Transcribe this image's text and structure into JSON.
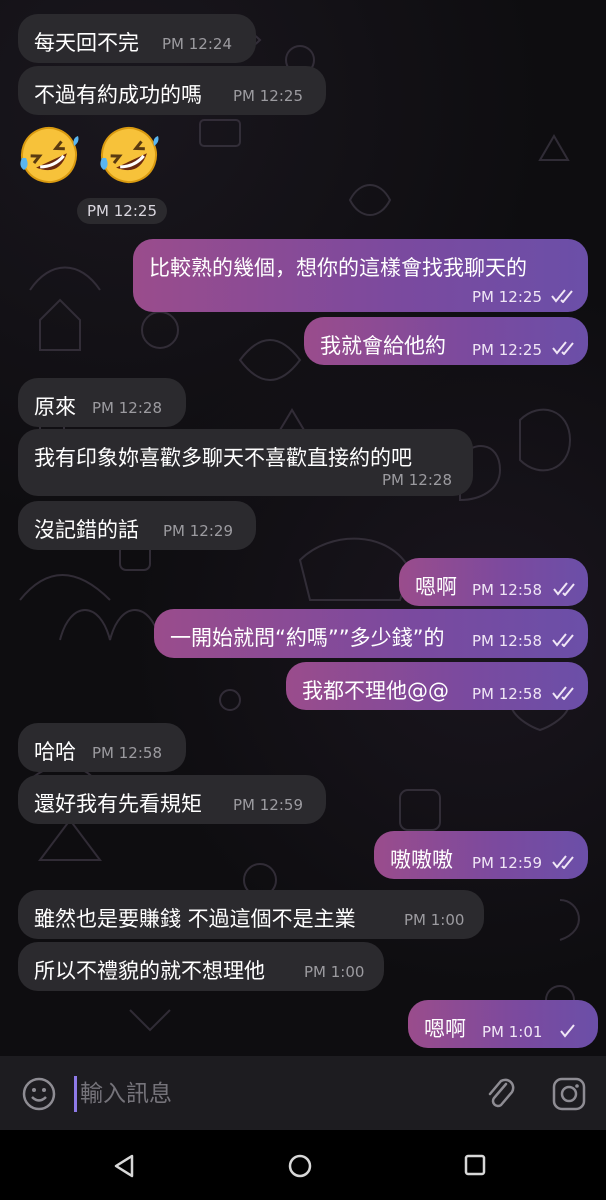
{
  "conversation": {
    "messages": [
      {
        "id": "m1",
        "dir": "in",
        "text": "每天回不完",
        "time": "PM 12:24"
      },
      {
        "id": "m2",
        "dir": "in",
        "text": "不過有約成功的嗎",
        "time": "PM 12:25"
      },
      {
        "id": "m3",
        "dir": "in",
        "emoji": [
          "rolling-on-floor-laughing",
          "rolling-on-floor-laughing"
        ],
        "time": "PM 12:25"
      },
      {
        "id": "m4",
        "dir": "out",
        "text": "比較熟的幾個，想你的這樣會找我聊天的",
        "time": "PM 12:25",
        "status": "read"
      },
      {
        "id": "m5",
        "dir": "out",
        "text": "我就會給他約",
        "time": "PM 12:25",
        "status": "read"
      },
      {
        "id": "m6",
        "dir": "in",
        "text": "原來",
        "time": "PM 12:28"
      },
      {
        "id": "m7",
        "dir": "in",
        "text": "我有印象妳喜歡多聊天不喜歡直接約的吧",
        "time": "PM 12:28"
      },
      {
        "id": "m8",
        "dir": "in",
        "text": "沒記錯的話",
        "time": "PM 12:29"
      },
      {
        "id": "m9",
        "dir": "out",
        "text": "嗯啊",
        "time": "PM 12:58",
        "status": "read"
      },
      {
        "id": "m10",
        "dir": "out",
        "text": "一開始就問“約嗎””多少錢”的",
        "time": "PM 12:58",
        "status": "read"
      },
      {
        "id": "m11",
        "dir": "out",
        "text": "我都不理他@@",
        "time": "PM 12:58",
        "status": "read"
      },
      {
        "id": "m12",
        "dir": "in",
        "text": "哈哈",
        "time": "PM 12:58"
      },
      {
        "id": "m13",
        "dir": "in",
        "text": "還好我有先看規矩",
        "time": "PM 12:59"
      },
      {
        "id": "m14",
        "dir": "out",
        "text": "嗷嗷嗷",
        "time": "PM 12:59",
        "status": "read"
      },
      {
        "id": "m15",
        "dir": "in",
        "text": "雖然也是要賺錢 不過這個不是主業",
        "time": "PM 1:00"
      },
      {
        "id": "m16",
        "dir": "in",
        "text": "所以不禮貌的就不想理他",
        "time": "PM 1:00"
      },
      {
        "id": "m17",
        "dir": "out",
        "text": "嗯啊",
        "time": "PM 1:01",
        "status": "sent"
      }
    ]
  },
  "composer": {
    "placeholder": "輸入訊息",
    "icons": [
      "smiley-icon",
      "paperclip-icon",
      "camera-icon"
    ]
  },
  "navigation": {
    "icons": [
      "back-icon",
      "home-icon",
      "recents-icon"
    ]
  },
  "colors": {
    "incoming_bubble": "#2b2a2e",
    "outgoing_bubble_start": "#9a4c8c",
    "outgoing_bubble_end": "#6b4fa8",
    "caret": "#8e7ae8"
  }
}
